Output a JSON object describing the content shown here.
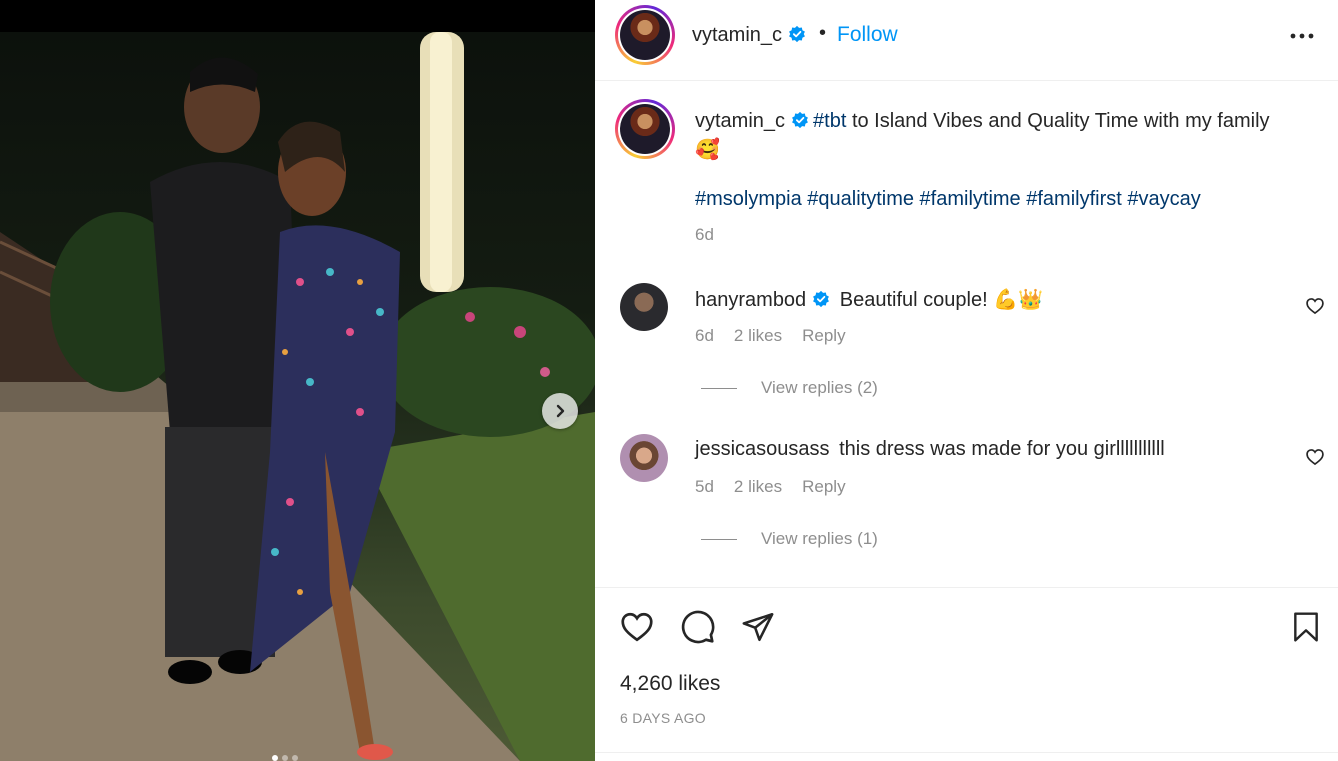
{
  "post": {
    "username": "vytamin_c",
    "separator": "•",
    "follow_label": "Follow",
    "more_icon": "more-horizontal-icon"
  },
  "caption": {
    "username": "vytamin_c",
    "first_tag": "#tbt",
    "text": " to Island Vibes and Quality Time with my family",
    "emoji": "🥰",
    "hashtags": [
      "#msolympia",
      "#qualitytime",
      "#familytime",
      "#familyfirst",
      "#vaycay"
    ],
    "time": "6d"
  },
  "comments": [
    {
      "username": "hanyrambod",
      "verified": true,
      "text": "Beautiful couple!",
      "emoji": "💪👑",
      "time": "6d",
      "likes": "2 likes",
      "reply_label": "Reply",
      "view_replies": "View replies (2)"
    },
    {
      "username": "jessicasousass",
      "verified": false,
      "text": "this dress was made for you girlllllllllll",
      "emoji": "",
      "time": "5d",
      "likes": "2 likes",
      "reply_label": "Reply",
      "view_replies": "View replies (1)"
    }
  ],
  "footer": {
    "likes": "4,260 likes",
    "date": "6 DAYS AGO"
  },
  "colors": {
    "accent": "#0095f6",
    "hashtag": "#00376b",
    "muted": "#8e8e8e",
    "text": "#262626",
    "verified": "#0095f6"
  },
  "icons": [
    "heart-icon",
    "comment-icon",
    "share-icon",
    "bookmark-icon",
    "verified-badge-icon",
    "chevron-right-icon"
  ]
}
